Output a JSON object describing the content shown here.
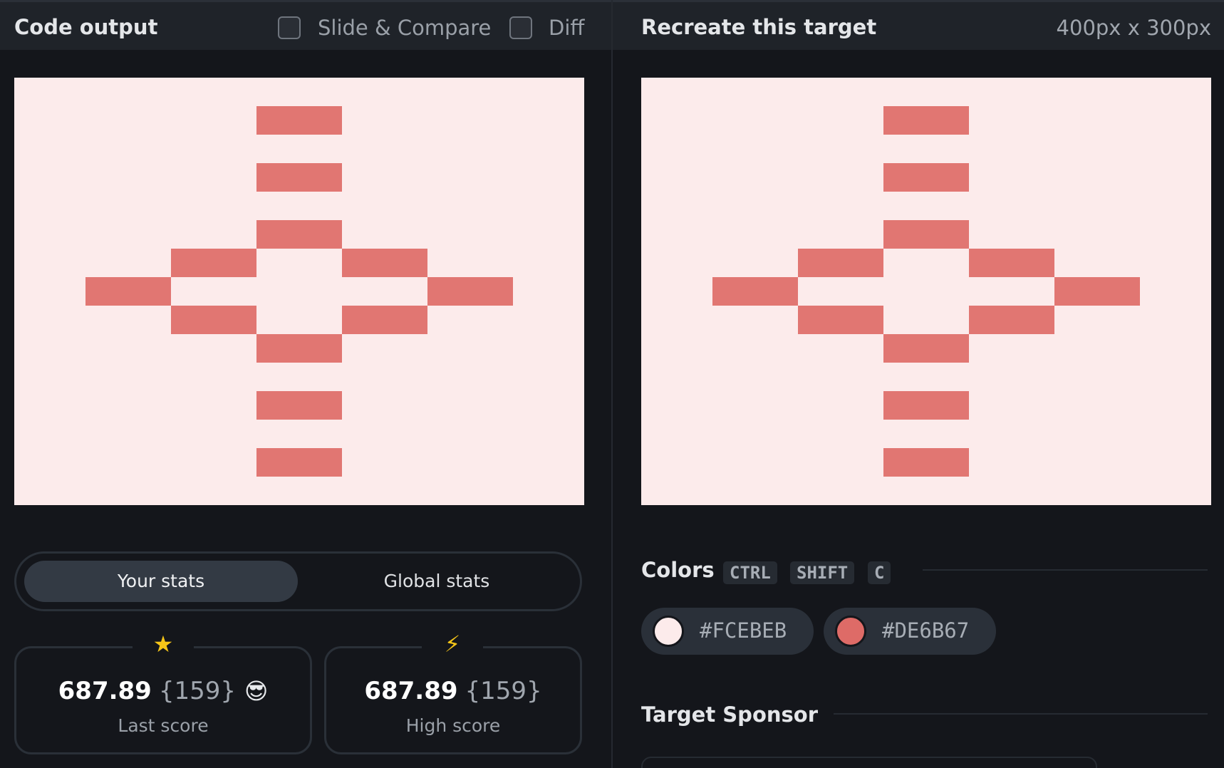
{
  "left_panel": {
    "title": "Code output",
    "slide_compare_label": "Slide & Compare",
    "diff_label": "Diff",
    "stats_tabs": {
      "active": "Your stats",
      "inactive": "Global stats"
    },
    "last_score": {
      "value": "687.89",
      "count": "{159}",
      "emoji": "😎",
      "caption": "Last score",
      "icon": "★"
    },
    "high_score": {
      "value": "687.89",
      "count": "{159}",
      "caption": "High score",
      "icon": "⚡"
    }
  },
  "right_panel": {
    "title": "Recreate this target",
    "size": "400px x 300px",
    "colors_heading": "Colors",
    "shortcut_keys": [
      "CTRL",
      "SHIFT",
      "C"
    ],
    "colors": [
      {
        "hex": "#FCEBEB",
        "label": "#FCEBEB"
      },
      {
        "hex": "#DE6B67",
        "label": "#DE6B67"
      }
    ],
    "sponsor_heading": "Target Sponsor"
  },
  "palette": {
    "background": "#FCEBEB",
    "accent": "#DE6B67"
  }
}
